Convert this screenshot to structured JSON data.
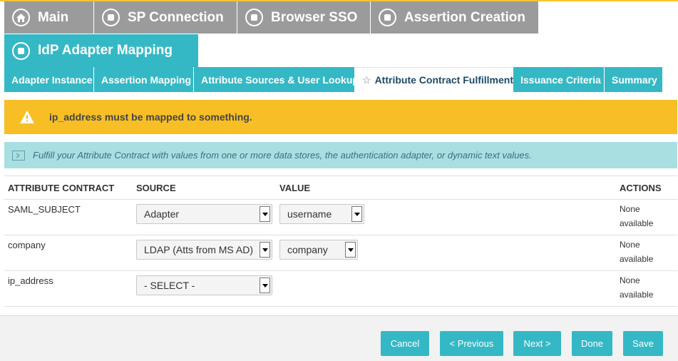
{
  "breadcrumb": [
    {
      "label": "Main",
      "icon": "home-icon"
    },
    {
      "label": "SP Connection",
      "icon": "stop-circle-icon"
    },
    {
      "label": "Browser SSO",
      "icon": "stop-circle-icon"
    },
    {
      "label": "Assertion Creation",
      "icon": "stop-circle-icon"
    }
  ],
  "page": {
    "title": "IdP Adapter Mapping"
  },
  "tabs": [
    {
      "label": "Adapter Instance"
    },
    {
      "label": "Assertion Mapping"
    },
    {
      "label": "Attribute Sources & User Lookup"
    },
    {
      "label": "Attribute Contract Fulfillment",
      "active": true
    },
    {
      "label": "Issuance Criteria"
    },
    {
      "label": "Summary"
    }
  ],
  "warning": {
    "text": "ip_address must be mapped to something."
  },
  "info": {
    "text": "Fulfill your Attribute Contract with values from one or more data stores, the authentication adapter, or dynamic text values."
  },
  "table": {
    "headers": {
      "contract": "ATTRIBUTE CONTRACT",
      "source": "SOURCE",
      "value": "VALUE",
      "actions": "ACTIONS"
    },
    "rows": [
      {
        "contract": "SAML_SUBJECT",
        "source": "Adapter",
        "value": "username",
        "action_line1": "None",
        "action_line2": "available"
      },
      {
        "contract": "company",
        "source": "LDAP (Atts from MS AD)",
        "value": "company",
        "action_line1": "None",
        "action_line2": "available"
      },
      {
        "contract": "ip_address",
        "source": "- SELECT -",
        "value": "",
        "action_line1": "None",
        "action_line2": "available"
      }
    ]
  },
  "buttons": {
    "cancel": "Cancel",
    "previous": "< Previous",
    "next": "Next >",
    "done": "Done",
    "save": "Save"
  },
  "colors": {
    "accent": "#35b8c6",
    "breadcrumb": "#9b9b9b",
    "warning": "#f7bf25",
    "info": "#a9dfe0"
  }
}
